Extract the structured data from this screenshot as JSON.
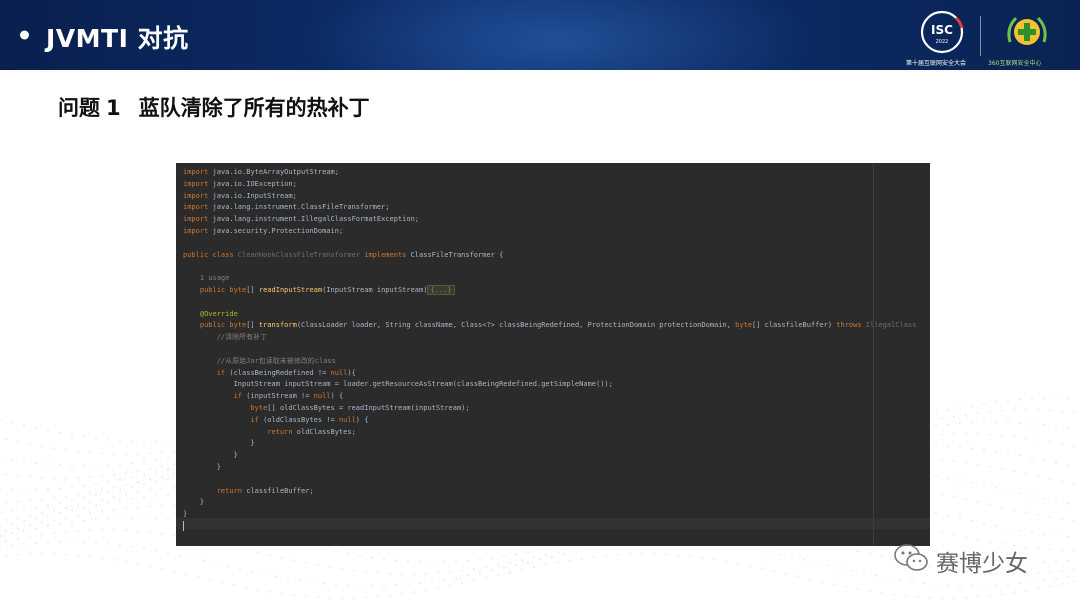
{
  "header": {
    "title": "JVMTI 对抗",
    "isc_logo_text": "ISC",
    "isc_logo_year": "2022",
    "isc_caption": "第十届互联网安全大会",
    "partner_caption": "360互联网安全中心"
  },
  "slide": {
    "heading_prefix": "问题",
    "heading_number": "1",
    "heading_text": "蓝队清除了所有的热补丁"
  },
  "code": {
    "lines": [
      [
        "kw:import",
        "t: java.io.ByteArrayOutputStream;"
      ],
      [
        "kw:import",
        "t: java.io.IOException;"
      ],
      [
        "kw:import",
        "t: java.io.InputStream;"
      ],
      [
        "kw:import",
        "t: java.lang.instrument.ClassFileTransformer;"
      ],
      [
        "kw:import",
        "t: java.lang.instrument.IllegalClassFormatException;"
      ],
      [
        "kw:import",
        "t: java.security.ProtectionDomain;"
      ],
      [],
      [
        "kw:public class ",
        "dim:CleanHookClassFileTransformer",
        "kw: implements",
        "t: ClassFileTransformer {"
      ],
      [],
      [
        "cm:    1 usage"
      ],
      [
        "kw:    public byte",
        "t:[] ",
        "fn:readInputStream",
        "t:(InputStream inputStream)",
        "fold:{...}"
      ],
      [],
      [
        "an:    @Override"
      ],
      [
        "kw:    public byte",
        "t:[] ",
        "fn:transform",
        "t:(ClassLoader loader, String className, Class<?> classBeingRedefined, ProtectionDomain protectionDomain, ",
        "kw:byte",
        "t:[] classfileBuffer) ",
        "kw:throws",
        "dim: IllegalClass"
      ],
      [
        "cm:        //清除所有补丁"
      ],
      [],
      [
        "cm:        //从原始Jar包读取未被修改的class"
      ],
      [
        "kw:        if",
        "t: (classBeingRedefined != ",
        "kw:null",
        "t:){"
      ],
      [
        "t:            InputStream inputStream = loader.getResourceAsStream(classBeingRedefined.getSimpleName());"
      ],
      [
        "kw:            if",
        "t: (inputStream != ",
        "kw:null",
        "t:) {"
      ],
      [
        "kw:                byte",
        "t:[] oldClassBytes = readInputStream(inputStream);"
      ],
      [
        "kw:                if",
        "t: (oldClassBytes != ",
        "kw:null",
        "t:) {"
      ],
      [
        "kw:                    return",
        "t: oldClassBytes;"
      ],
      [
        "t:                }"
      ],
      [
        "t:            }"
      ],
      [
        "t:        }"
      ],
      [],
      [
        "kw:        return",
        "t: classfileBuffer;"
      ],
      [
        "t:    }"
      ],
      [
        "t:}"
      ],
      [
        "caret:"
      ]
    ]
  },
  "watermark": {
    "text": "赛博少女",
    "icon": "wechat-icon"
  },
  "colors": {
    "banner": "#0d2f6e",
    "editor_bg": "#2b2b2b",
    "keyword": "#cc7832",
    "annotation": "#bbb529",
    "comment": "#808080",
    "method": "#ffc66d",
    "text": "#a9b7c6"
  }
}
